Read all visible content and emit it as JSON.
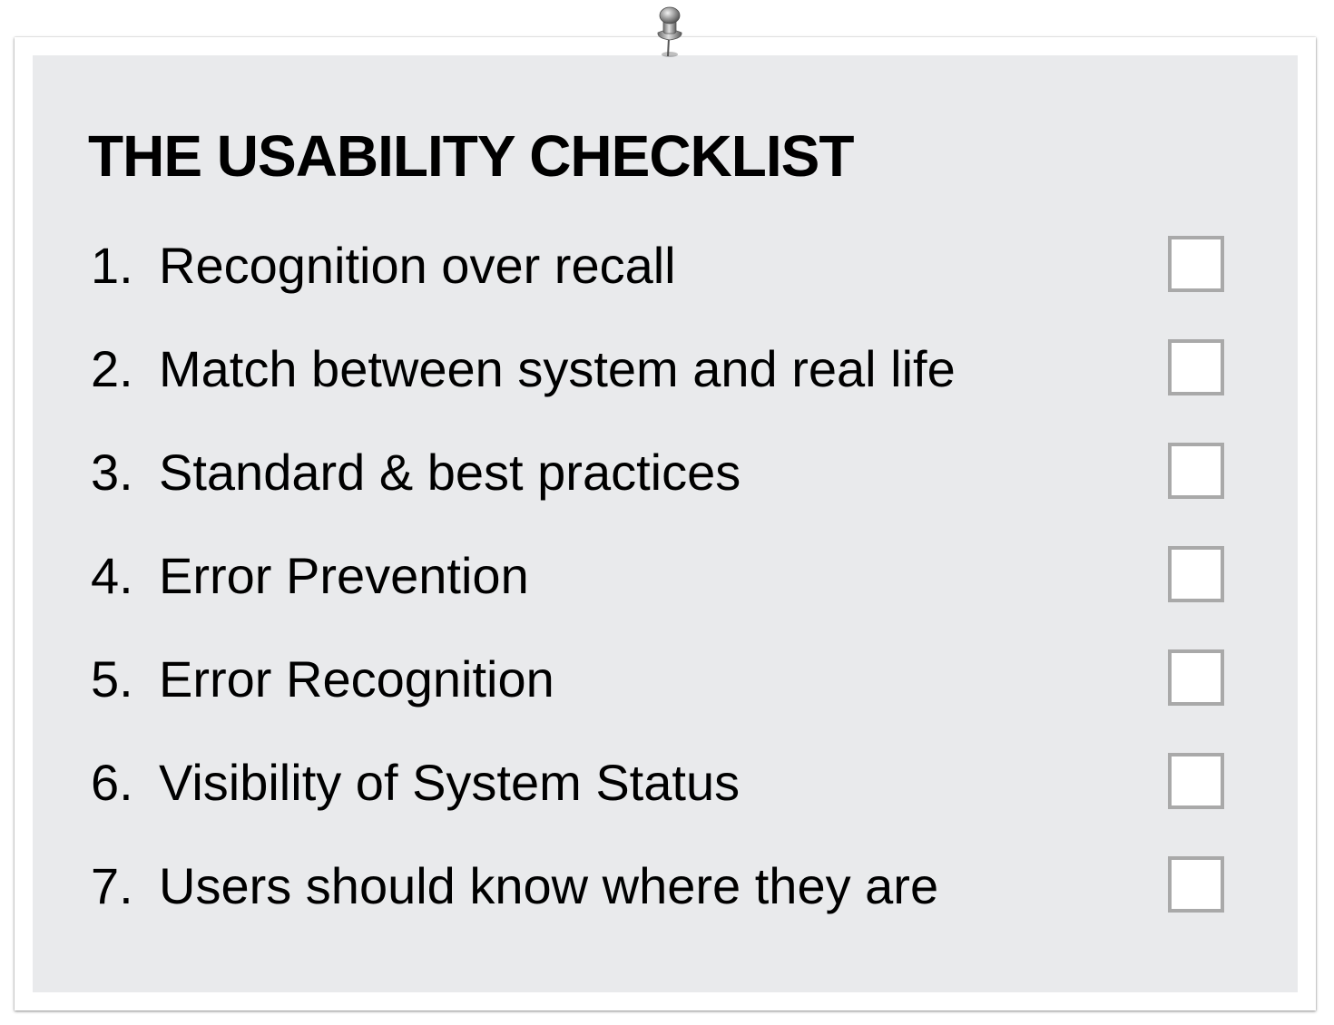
{
  "checklist": {
    "title": "THE USABILITY CHECKLIST",
    "pin_icon": "push-pin-icon",
    "items": [
      {
        "number": "1.",
        "label": "Recognition over recall",
        "checked": false
      },
      {
        "number": "2.",
        "label": "Match between system and real life",
        "checked": false
      },
      {
        "number": "3.",
        "label": "Standard & best practices",
        "checked": false
      },
      {
        "number": "4.",
        "label": "Error Prevention",
        "checked": false
      },
      {
        "number": "5.",
        "label": "Error Recognition",
        "checked": false
      },
      {
        "number": "6.",
        "label": "Visibility of System Status",
        "checked": false
      },
      {
        "number": "7.",
        "label": "Users should know where they are",
        "checked": false
      }
    ]
  },
  "colors": {
    "card_background": "#e9eaec",
    "frame_background": "#ffffff",
    "text": "#000000",
    "checkbox_border": "#a9a9a9",
    "checkbox_fill": "#ffffff"
  }
}
